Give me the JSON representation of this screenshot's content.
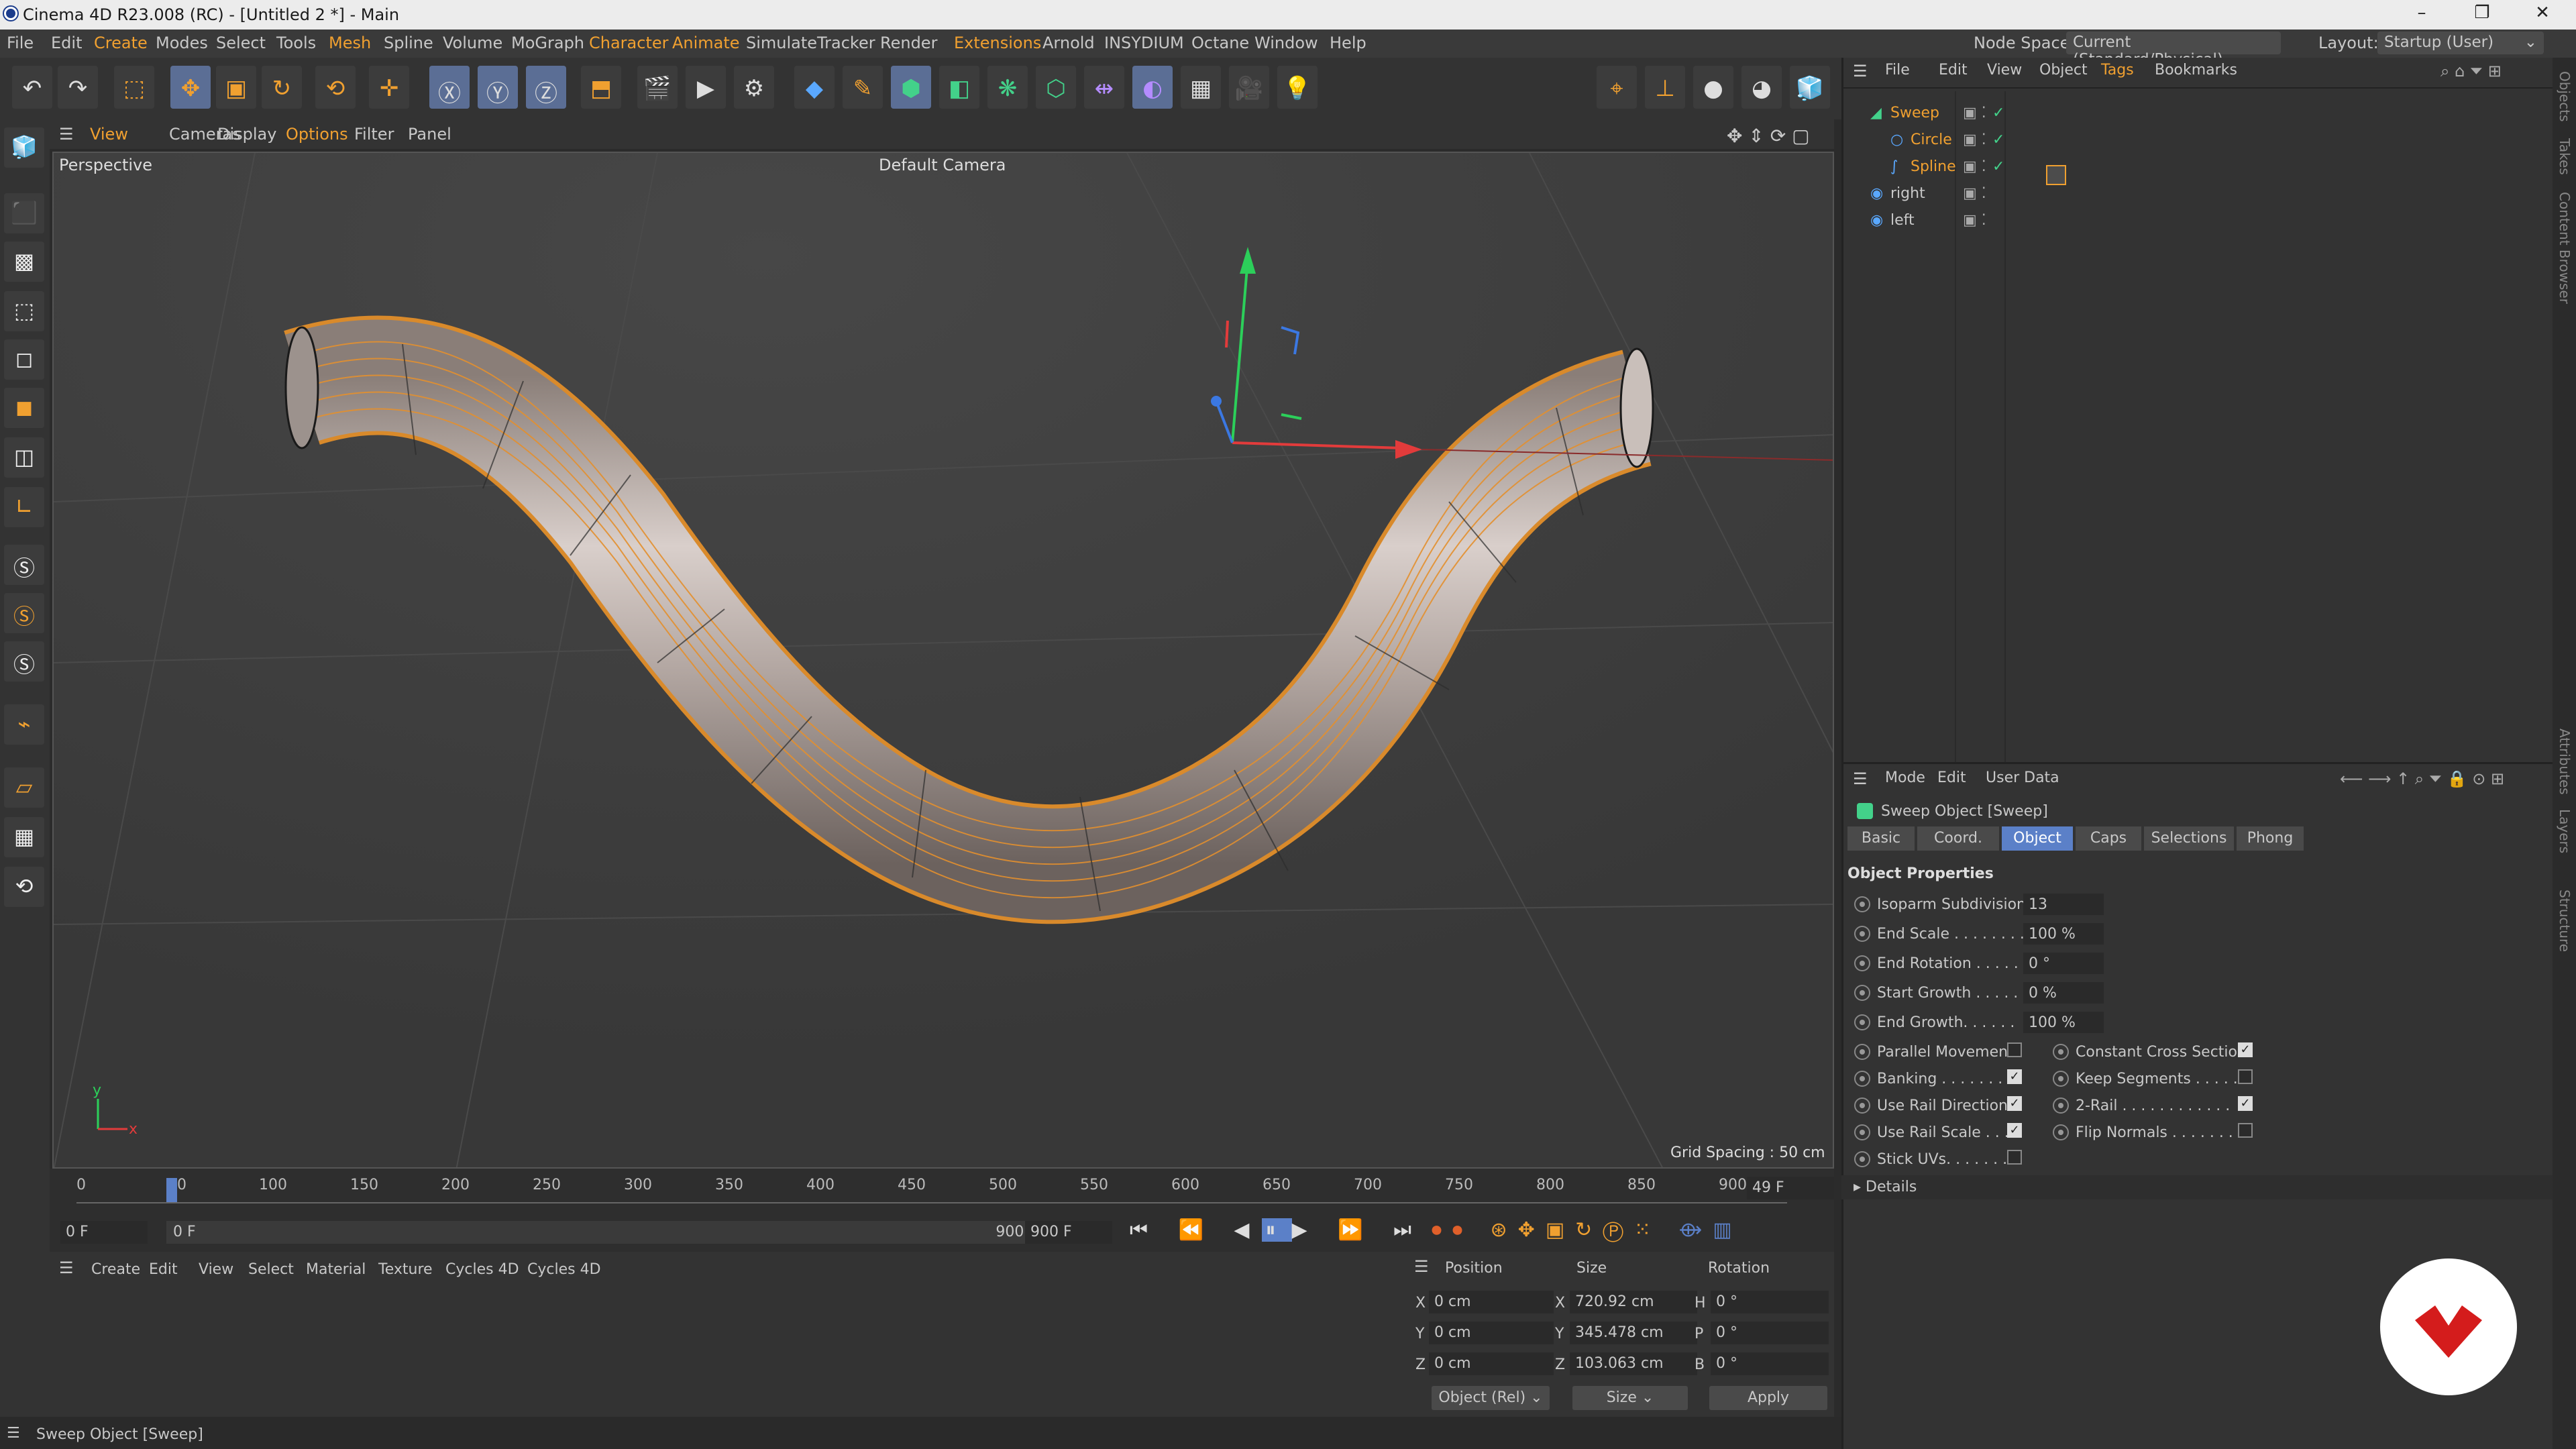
{
  "window": {
    "title": "Cinema 4D R23.008 (RC) - [Untitled 2 *] - Main",
    "min": "–",
    "restore": "❐",
    "close": "✕"
  },
  "menu": [
    "File",
    "Edit",
    "Create",
    "Modes",
    "Select",
    "Tools",
    "Mesh",
    "Spline",
    "Volume",
    "MoGraph",
    "Character",
    "Animate",
    "Simulate",
    "Tracker",
    "Render",
    "Extensions",
    "Arnold",
    "INSYDIUM",
    "Octane",
    "Window",
    "Help"
  ],
  "highlighted_menus": [
    "Create",
    "Mesh",
    "Character",
    "Animate",
    "Extensions"
  ],
  "node_space": {
    "label": "Node Space:",
    "value": "Current (Standard/Physical)"
  },
  "layout": {
    "label": "Layout:",
    "value": "Startup (User)"
  },
  "viewport_menu": [
    "View",
    "Cameras",
    "Display",
    "Options",
    "Filter",
    "Panel"
  ],
  "viewport": {
    "name": "Perspective",
    "camera": "Default Camera",
    "grid_spacing": "Grid Spacing : 50 cm"
  },
  "timeline": {
    "ticks": [
      "0",
      "50",
      "100",
      "150",
      "200",
      "250",
      "300",
      "350",
      "400",
      "450",
      "500",
      "550",
      "600",
      "650",
      "700",
      "750",
      "800",
      "850",
      "900"
    ],
    "current_frame": "49 F",
    "start": "0 F",
    "range_start": "0 F",
    "range_end": "900 F",
    "end": "900 F"
  },
  "material_menu": [
    "Create",
    "Edit",
    "View",
    "Select",
    "Material",
    "Texture",
    "Cycles 4D",
    "Cycles 4D"
  ],
  "coords": {
    "headers": [
      "Position",
      "Size",
      "Rotation"
    ],
    "rows": [
      {
        "axis": "X",
        "pos": "0 cm",
        "saxis": "X",
        "size": "720.92 cm",
        "raxis": "H",
        "rot": "0 °"
      },
      {
        "axis": "Y",
        "pos": "0 cm",
        "saxis": "Y",
        "size": "345.478 cm",
        "raxis": "P",
        "rot": "0 °"
      },
      {
        "axis": "Z",
        "pos": "0 cm",
        "saxis": "Z",
        "size": "103.063 cm",
        "raxis": "B",
        "rot": "0 °"
      }
    ],
    "mode": "Object (Rel)",
    "size_mode": "Size",
    "apply": "Apply"
  },
  "status": "Sweep Object [Sweep]",
  "objects_menu": [
    "File",
    "Edit",
    "View",
    "Object",
    "Tags",
    "Bookmarks"
  ],
  "objects": [
    {
      "name": "Sweep",
      "color": "#f0a030"
    },
    {
      "name": "Circle",
      "color": "#f0a030"
    },
    {
      "name": "Spline",
      "color": "#f0a030"
    },
    {
      "name": "right",
      "color": "#c8c8c8"
    },
    {
      "name": "left",
      "color": "#c8c8c8"
    }
  ],
  "attr_menu": [
    "Mode",
    "Edit",
    "User Data"
  ],
  "attr_title": "Sweep Object [Sweep]",
  "attr_tabs": [
    "Basic",
    "Coord.",
    "Object",
    "Caps",
    "Selections",
    "Phong"
  ],
  "section": "Object Properties",
  "props": [
    {
      "label": "Isoparm Subdivision",
      "value": "13"
    },
    {
      "label": "End Scale . . . . . . . .",
      "value": "100 %"
    },
    {
      "label": "End Rotation . . . . . .",
      "value": "0 °"
    },
    {
      "label": "Start Growth . . . . .",
      "value": "0 %"
    },
    {
      "label": "End Growth. . . . . .",
      "value": "100 %"
    }
  ],
  "checks_left": [
    {
      "label": "Parallel Movement",
      "checked": false
    },
    {
      "label": "Banking . . . . . . . .",
      "checked": true
    },
    {
      "label": "Use Rail Direction",
      "checked": true
    },
    {
      "label": "Use Rail Scale . . . .",
      "checked": true
    },
    {
      "label": "Stick UVs. . . . . . . .",
      "checked": false
    }
  ],
  "checks_right": [
    {
      "label": "Constant Cross Section",
      "checked": true
    },
    {
      "label": "Keep Segments . . . . .",
      "checked": false
    },
    {
      "label": "2-Rail . . . . . . . . . . . .",
      "checked": true
    },
    {
      "label": "Flip Normals . . . . . . .",
      "checked": false
    }
  ],
  "details": "Details",
  "side_tabs": [
    "Objects",
    "Takes",
    "Content Browser",
    "Attributes",
    "Layers",
    "Structure"
  ],
  "accent": "#f0a030",
  "selection_blue": "#5b80c8"
}
